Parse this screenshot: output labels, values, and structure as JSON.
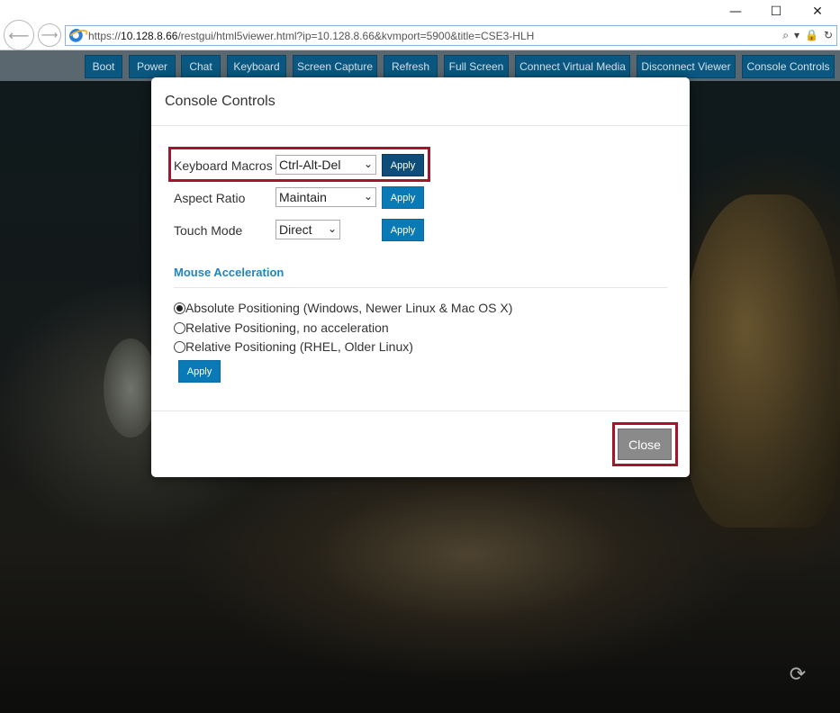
{
  "browser": {
    "url_prefix": "https://",
    "url_host": "10.128.8.66",
    "url_path": "/restgui/html5viewer.html?ip=10.128.8.66&kvmport=5900&title=CSE3-HLH",
    "window_controls": {
      "minimize": "—",
      "maximize": "☐",
      "close": "✕"
    },
    "nav": {
      "back": "⟵",
      "forward": "⟶"
    },
    "address_tools": {
      "search": "⌕",
      "dropdown": "▾",
      "lock": "🔒",
      "refresh": "↻"
    }
  },
  "toolbar": {
    "buttons": [
      "Boot",
      "Power",
      "Chat",
      "Keyboard",
      "Screen Capture",
      "Refresh",
      "Full Screen",
      "Connect Virtual Media",
      "Disconnect Viewer",
      "Console Controls"
    ]
  },
  "modal": {
    "title": "Console Controls",
    "keyboard_macros": {
      "label": "Keyboard Macros",
      "selected": "Ctrl-Alt-Del",
      "apply": "Apply"
    },
    "aspect_ratio": {
      "label": "Aspect Ratio",
      "selected": "Maintain",
      "apply": "Apply"
    },
    "touch_mode": {
      "label": "Touch Mode",
      "selected": "Direct",
      "apply": "Apply"
    },
    "mouse_acceleration": {
      "title": "Mouse Acceleration",
      "options": [
        {
          "label": "Absolute Positioning (Windows, Newer Linux & Mac OS X)",
          "checked": true
        },
        {
          "label": "Relative Positioning, no acceleration",
          "checked": false
        },
        {
          "label": "Relative Positioning (RHEL, Older Linux)",
          "checked": false
        }
      ],
      "apply": "Apply"
    },
    "close": "Close"
  },
  "icons": {
    "select_chevron": "⌄",
    "restore": "⟳"
  },
  "colors": {
    "button_blue": "#0a7ab7",
    "toolbar_button": "#0a5a85",
    "highlight_red": "#a3152d",
    "section_blue": "#1f85bf"
  }
}
